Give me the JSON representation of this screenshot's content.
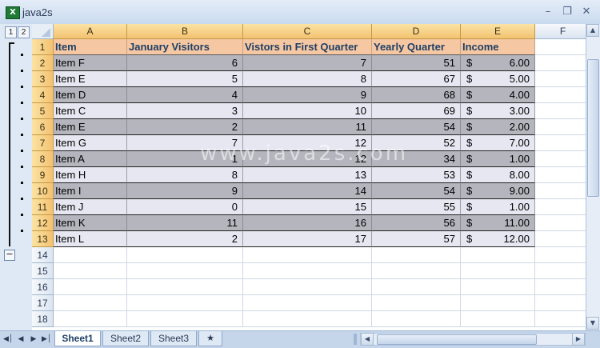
{
  "window": {
    "title": "java2s",
    "app_icon": "X"
  },
  "outline": {
    "levels": [
      "1",
      "2"
    ],
    "collapse_symbol": "−"
  },
  "columns": [
    "A",
    "B",
    "C",
    "D",
    "E",
    "F"
  ],
  "rows": [
    "1",
    "2",
    "3",
    "4",
    "5",
    "6",
    "7",
    "8",
    "9",
    "10",
    "11",
    "12",
    "13",
    "14",
    "15",
    "16",
    "17",
    "18"
  ],
  "table": {
    "headers": [
      "Item",
      "January Visitors",
      "Vistors in First Quarter",
      "Yearly Quarter",
      "Income"
    ],
    "data": [
      [
        "Item F",
        "6",
        "7",
        "51",
        "6.00"
      ],
      [
        "Item E",
        "5",
        "8",
        "67",
        "5.00"
      ],
      [
        "Item D",
        "4",
        "9",
        "68",
        "4.00"
      ],
      [
        "Item C",
        "3",
        "10",
        "69",
        "3.00"
      ],
      [
        "Item E",
        "2",
        "11",
        "54",
        "2.00"
      ],
      [
        "Item G",
        "7",
        "12",
        "52",
        "7.00"
      ],
      [
        "Item A",
        "1",
        "12",
        "34",
        "1.00"
      ],
      [
        "Item H",
        "8",
        "13",
        "53",
        "8.00"
      ],
      [
        "Item I",
        "9",
        "14",
        "54",
        "9.00"
      ],
      [
        "Item J",
        "0",
        "15",
        "55",
        "1.00"
      ],
      [
        "Item K",
        "11",
        "16",
        "56",
        "11.00"
      ],
      [
        "Item L",
        "2",
        "17",
        "57",
        "12.00"
      ]
    ],
    "currency_symbol": "$"
  },
  "watermark": "www.java2s.com",
  "sheet_tabs": [
    "Sheet1",
    "Sheet2",
    "Sheet3"
  ],
  "colors": {
    "header_fill": "#f5c7a2",
    "band_dark": "#b4b5bd",
    "band_light": "#e6e7f1",
    "selected_header": "#f3c271"
  }
}
